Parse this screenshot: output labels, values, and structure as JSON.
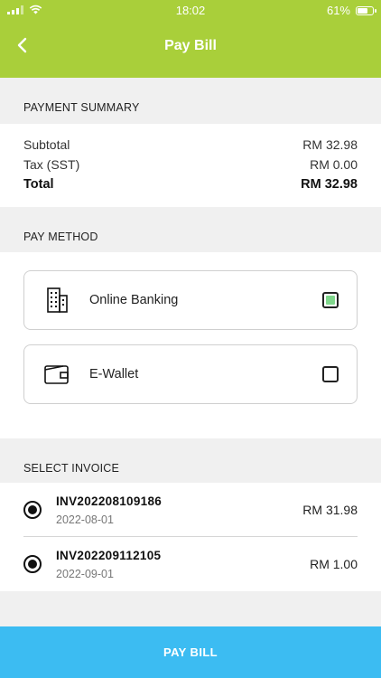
{
  "status_bar": {
    "time": "18:02",
    "battery": "61%",
    "battery_level": 0.61
  },
  "header": {
    "title": "Pay Bill"
  },
  "summary": {
    "section_label": "PAYMENT SUMMARY",
    "rows": [
      {
        "label": "Subtotal",
        "value": "RM 32.98"
      },
      {
        "label": "Tax (SST)",
        "value": "RM 0.00"
      }
    ],
    "total": {
      "label": "Total",
      "value": "RM 32.98"
    }
  },
  "pay_method": {
    "section_label": "PAY METHOD",
    "options": [
      {
        "label": "Online Banking",
        "icon": "building-icon",
        "checked": true
      },
      {
        "label": "E-Wallet",
        "icon": "wallet-icon",
        "checked": false
      }
    ]
  },
  "invoices": {
    "section_label": "SELECT INVOICE",
    "items": [
      {
        "number": "INV202208109186",
        "date": "2022-08-01",
        "amount": "RM 31.98",
        "selected": true
      },
      {
        "number": "INV202209112105",
        "date": "2022-09-01",
        "amount": "RM 1.00",
        "selected": true
      }
    ]
  },
  "footer": {
    "pay_button": "PAY BILL"
  },
  "colors": {
    "header": "#a9cf3a",
    "button": "#3cbcf2",
    "check": "#7fd68b"
  }
}
